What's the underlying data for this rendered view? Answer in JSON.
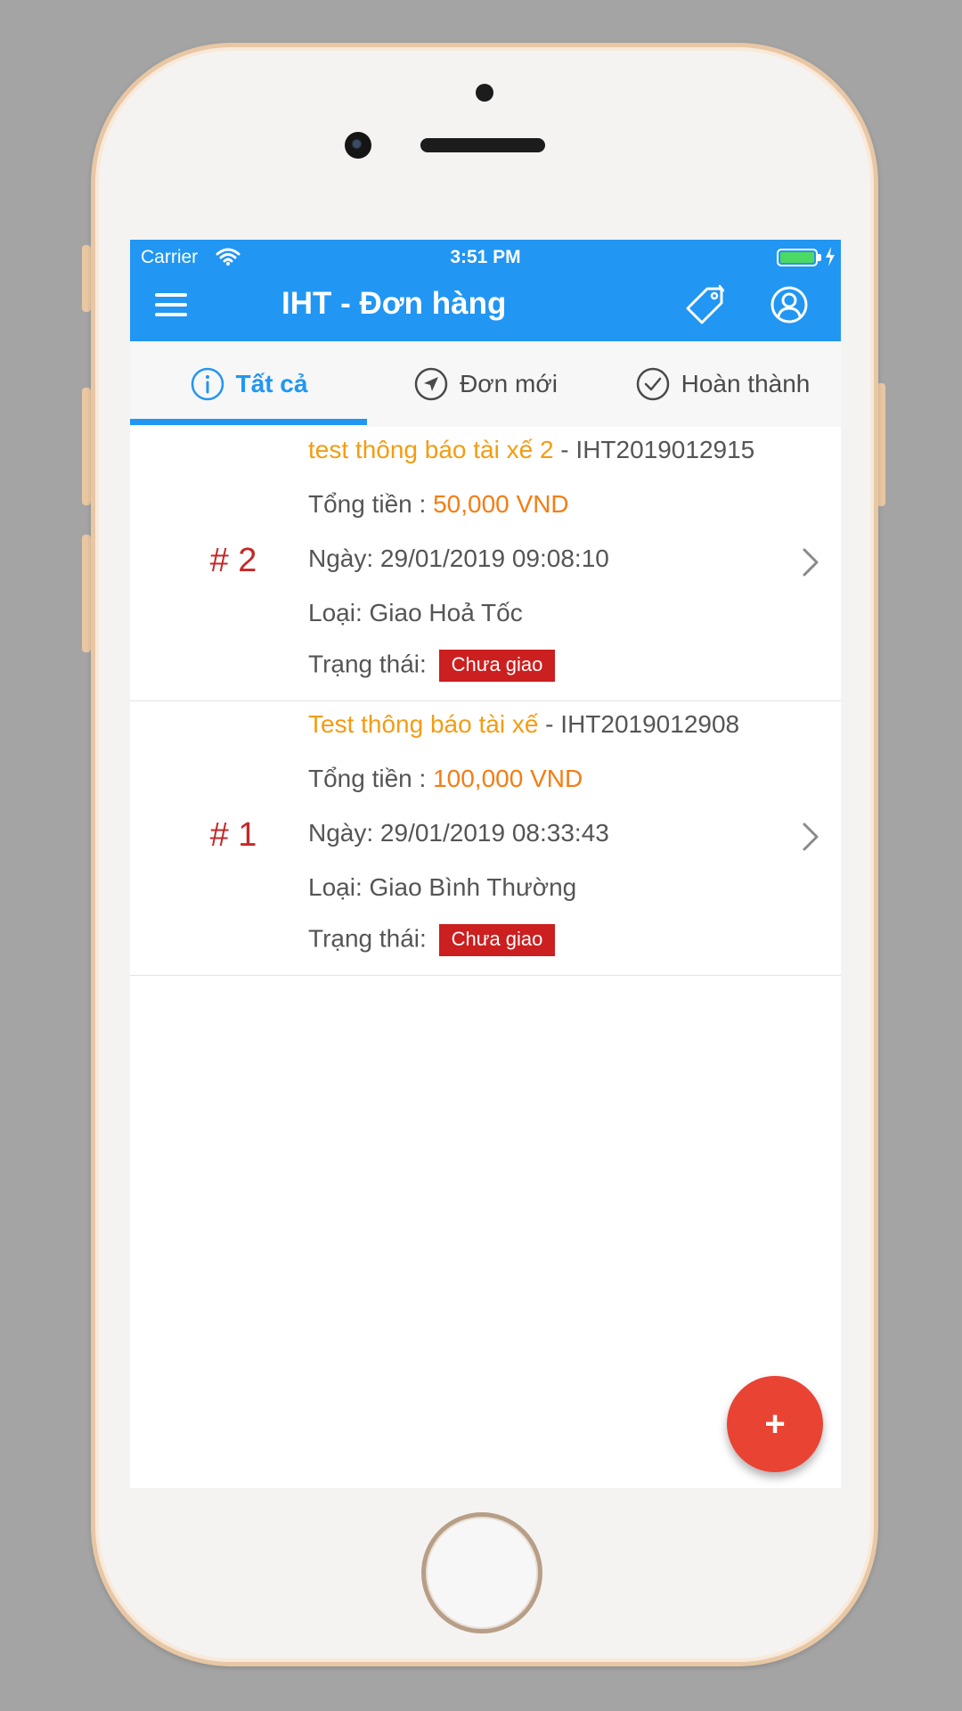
{
  "status_bar": {
    "carrier": "Carrier",
    "time": "3:51 PM",
    "wifi_icon": "wifi-icon",
    "battery_icon": "battery-charging-icon",
    "battery_level": 1.0
  },
  "navbar": {
    "title": "IHT - Đơn hàng",
    "menu_icon": "hamburger-menu-icon",
    "tag_icon": "tag-icon",
    "user_icon": "user-account-icon",
    "background_color": "#2196f3"
  },
  "tabs": [
    {
      "label": "Tất cả",
      "icon": "info-circle-icon",
      "active": true
    },
    {
      "label": "Đơn mới",
      "icon": "navigation-arrow-icon",
      "active": false
    },
    {
      "label": "Hoàn thành",
      "icon": "check-circle-icon",
      "active": false
    }
  ],
  "orders": [
    {
      "number": "# 2",
      "title": "test thông báo tài xế 2",
      "code": " - IHT2019012915",
      "total_label": "Tổng tiền : ",
      "total_value": "50,000 VND",
      "date": "Ngày: 29/01/2019 09:08:10",
      "type": "Loại: Giao Hoả Tốc",
      "status_label": "Trạng thái:",
      "status_badge": "Chưa giao"
    },
    {
      "number": "# 1",
      "title": "Test thông báo tài xế",
      "code": " - IHT2019012908",
      "total_label": "Tổng tiền : ",
      "total_value": "100,000 VND",
      "date": "Ngày: 29/01/2019 08:33:43",
      "type": "Loại: Giao Bình Thường",
      "status_label": "Trạng thái:",
      "status_badge": "Chưa giao"
    }
  ],
  "fab": {
    "label": "+",
    "color": "#e94333"
  }
}
